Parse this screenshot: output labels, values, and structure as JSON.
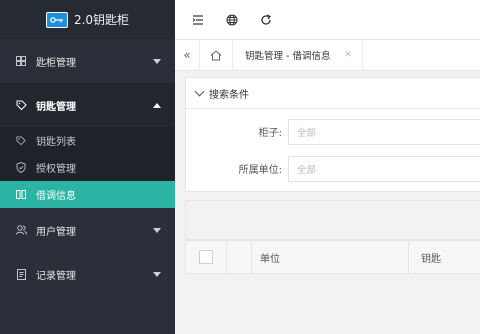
{
  "app": {
    "brand_name": "2.0钥匙柜"
  },
  "sidebar": {
    "items": [
      {
        "label": "匙柜管理",
        "icon": "cabinet-icon",
        "expanded": false
      },
      {
        "label": "钥匙管理",
        "icon": "tag-icon",
        "expanded": true,
        "children": [
          {
            "label": "钥匙列表",
            "icon": "tag-icon"
          },
          {
            "label": "授权管理",
            "icon": "shield-icon"
          },
          {
            "label": "借调信息",
            "icon": "columns-icon",
            "selected": true
          }
        ]
      },
      {
        "label": "用户管理",
        "icon": "users-icon",
        "expanded": false
      },
      {
        "label": "记录管理",
        "icon": "document-icon",
        "expanded": false
      }
    ]
  },
  "topbar": {
    "buttons": [
      "collapse-menu-icon",
      "globe-icon",
      "refresh-icon"
    ]
  },
  "tabs": {
    "active_tab_label": "钥匙管理 - 借调信息"
  },
  "search": {
    "section_title": "搜索条件",
    "fields": [
      {
        "label": "柜子:",
        "placeholder": "全部"
      },
      {
        "label": "所属单位:",
        "placeholder": "全部"
      }
    ]
  },
  "table": {
    "columns": [
      "单位",
      "钥匙"
    ]
  },
  "colors": {
    "sidebar_bg": "#2b2f3a",
    "selected_accent": "#2bb3a3"
  }
}
